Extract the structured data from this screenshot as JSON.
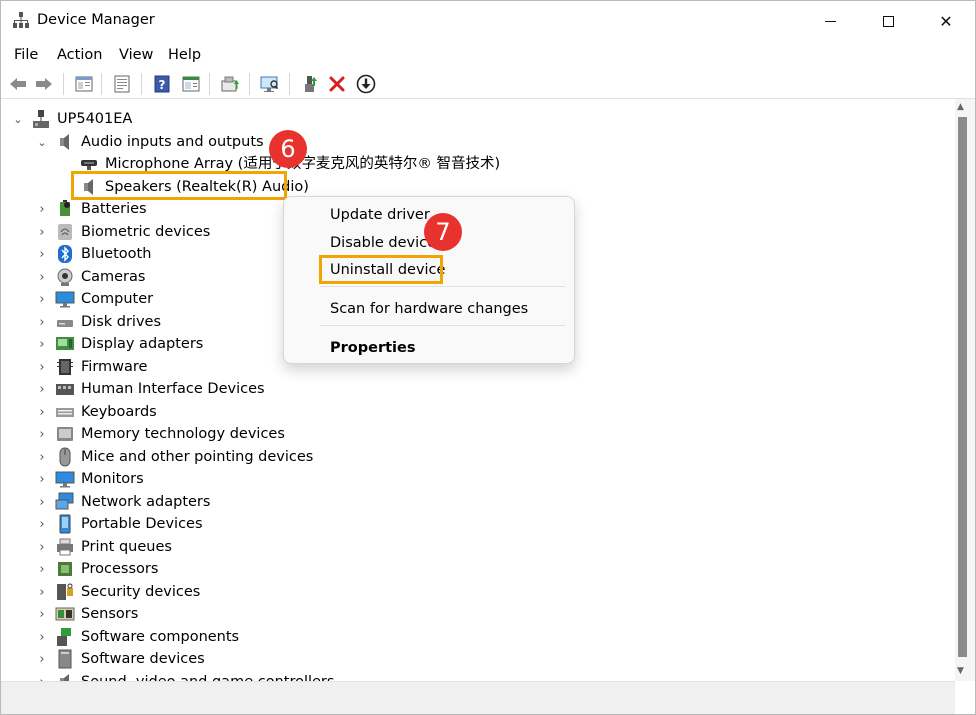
{
  "window": {
    "title": "Device Manager",
    "minimize_glyph": "",
    "close_glyph": "✕"
  },
  "menu": [
    "File",
    "Action",
    "View",
    "Help"
  ],
  "toolbar": {
    "icons": [
      "back-arrow-icon",
      "forward-arrow-icon",
      "properties-panel-icon",
      "properties-sheet-icon",
      "help-icon",
      "view-icon",
      "update-driver-icon",
      "scan-hardware-icon",
      "enable-device-icon",
      "uninstall-device-icon",
      "download-icon"
    ]
  },
  "tree": {
    "root": "UP5401EA",
    "expanded_category": "Audio inputs and outputs",
    "children": [
      "Microphone Array (适用于数字麦克风的英特尔® 智音技术)",
      "Speakers (Realtek(R) Audio)"
    ],
    "categories": [
      "Batteries",
      "Biometric devices",
      "Bluetooth",
      "Cameras",
      "Computer",
      "Disk drives",
      "Display adapters",
      "Firmware",
      "Human Interface Devices",
      "Keyboards",
      "Memory technology devices",
      "Mice and other pointing devices",
      "Monitors",
      "Network adapters",
      "Portable Devices",
      "Print queues",
      "Processors",
      "Security devices",
      "Sensors",
      "Software components",
      "Software devices",
      "Sound, video and game controllers"
    ]
  },
  "context_menu": {
    "update": "Update driver",
    "disable": "Disable device",
    "uninstall": "Uninstall device",
    "scan": "Scan for hardware changes",
    "properties": "Properties"
  },
  "badges": {
    "step6": "6",
    "step7": "7"
  },
  "colors": {
    "highlight": "#f0a500",
    "badge": "#e8322d",
    "uninstall_red": "#d81e1e"
  },
  "glyphs": {
    "expanded": "⌄",
    "collapsed": "›"
  }
}
